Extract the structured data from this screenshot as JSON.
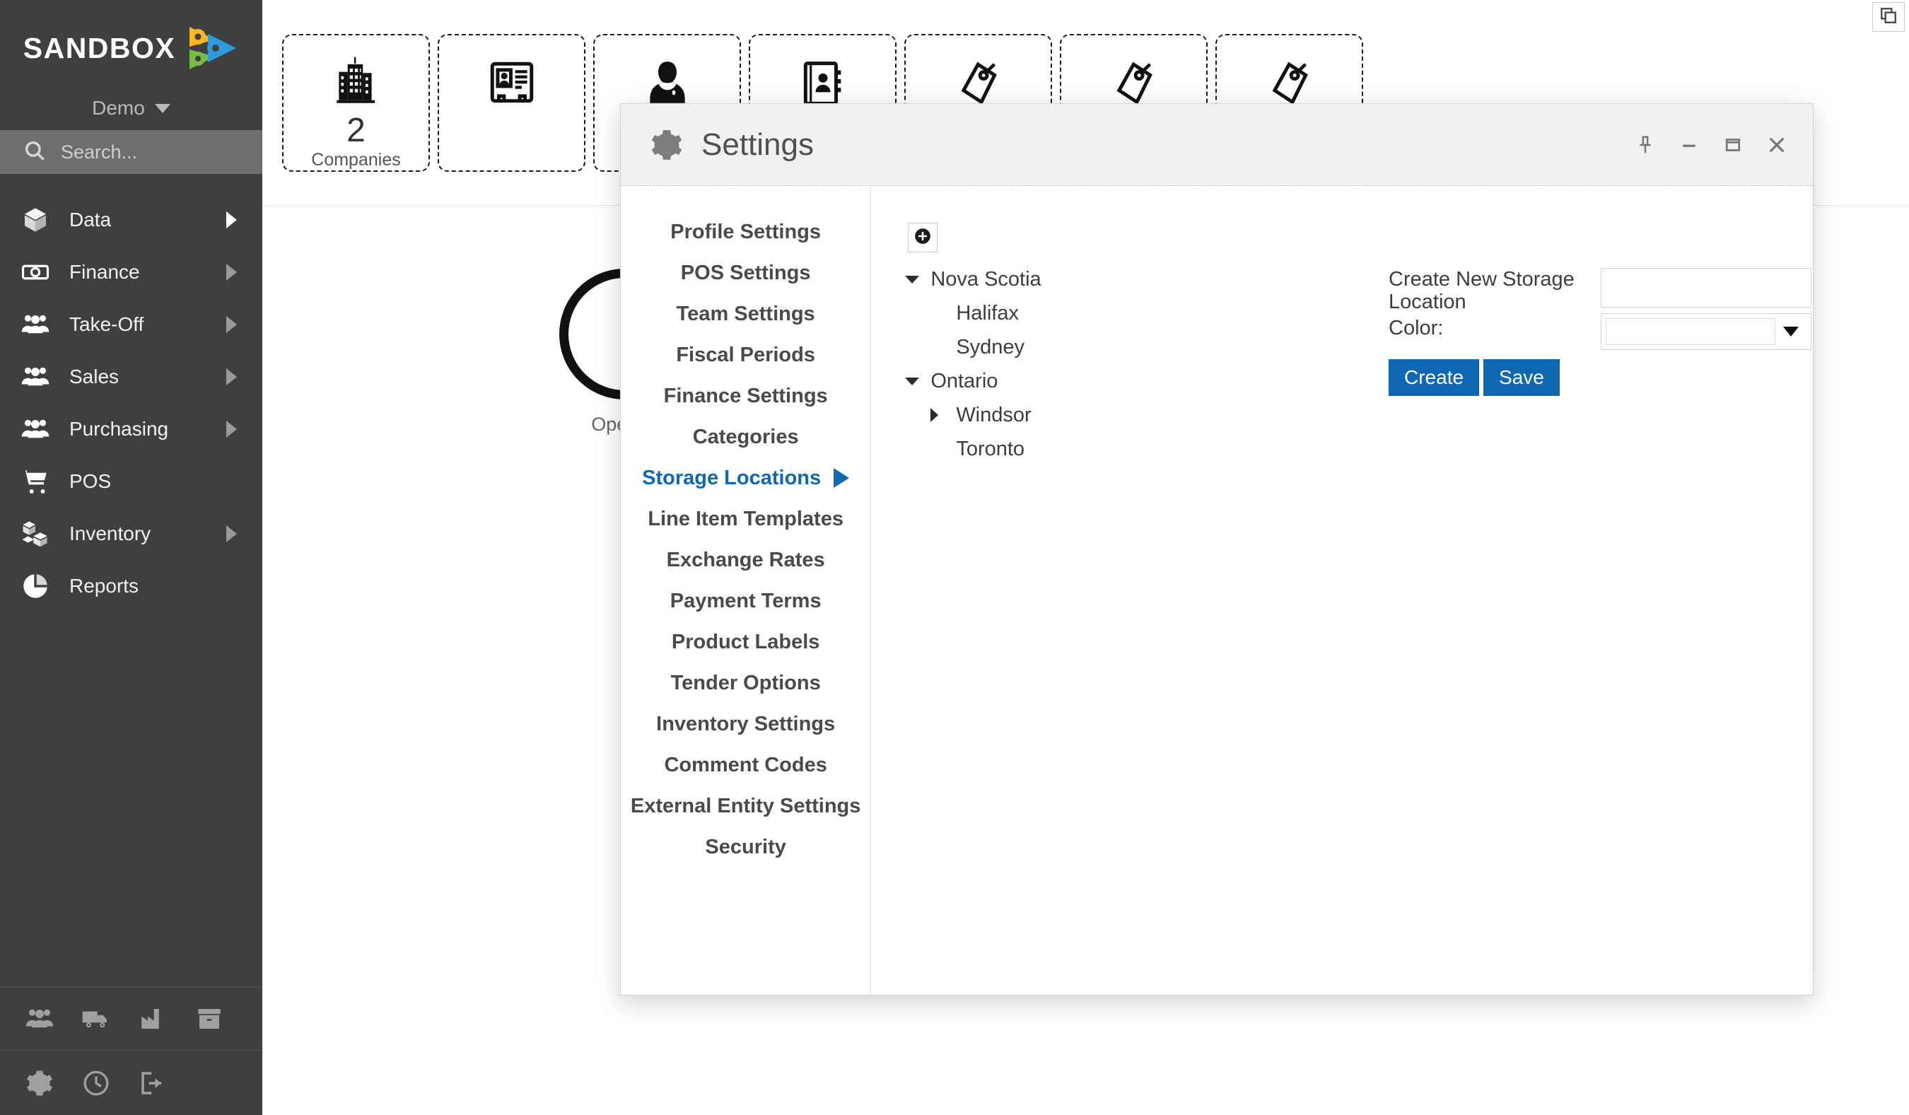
{
  "brand": {
    "name": "SANDBOX",
    "logo_icon": "sandbox-play-gears-logo",
    "tenant": "Demo",
    "tenant_caret_icon": "chevron-down-icon"
  },
  "search": {
    "placeholder": "Search...",
    "value": "",
    "icon": "search-icon"
  },
  "sidebar": {
    "items": [
      {
        "label": "Data",
        "icon": "box-icon",
        "has_chevron": true,
        "chevron_bright": true
      },
      {
        "label": "Finance",
        "icon": "banknote-icon",
        "has_chevron": true,
        "chevron_bright": false
      },
      {
        "label": "Take-Off",
        "icon": "people-icon",
        "has_chevron": true,
        "chevron_bright": false
      },
      {
        "label": "Sales",
        "icon": "people-icon",
        "has_chevron": true,
        "chevron_bright": false
      },
      {
        "label": "Purchasing",
        "icon": "people-icon",
        "has_chevron": true,
        "chevron_bright": false
      },
      {
        "label": "POS",
        "icon": "shopping-cart-icon",
        "has_chevron": false,
        "chevron_bright": false
      },
      {
        "label": "Inventory",
        "icon": "boxes-icon",
        "has_chevron": true,
        "chevron_bright": false
      },
      {
        "label": "Reports",
        "icon": "pie-chart-icon",
        "has_chevron": false,
        "chevron_bright": false
      }
    ],
    "tools_row1": [
      {
        "icon": "people-icon"
      },
      {
        "icon": "truck-icon"
      },
      {
        "icon": "factory-icon"
      },
      {
        "icon": "archive-box-icon"
      }
    ],
    "tools_row2": [
      {
        "icon": "gear-icon"
      },
      {
        "icon": "clock-icon"
      },
      {
        "icon": "logout-icon"
      }
    ]
  },
  "topbar": {
    "window_switcher_icon": "stacked-windows-icon"
  },
  "tabs": [
    {
      "icon": "office-buildings-icon",
      "count": "2",
      "label": "Companies"
    },
    {
      "icon": "id-card-icon",
      "count": "",
      "label": ""
    },
    {
      "icon": "person-silhouette-icon",
      "count": "",
      "label": ""
    },
    {
      "icon": "address-book-icon",
      "count": "",
      "label": ""
    },
    {
      "icon": "price-tag-icon",
      "count": "",
      "label": ""
    },
    {
      "icon": "price-tag-icon",
      "count": "",
      "label": ""
    },
    {
      "icon": "price-tag-icon",
      "count": "",
      "label": ""
    }
  ],
  "kpi": {
    "label": "Open Ti",
    "chart_icon": "donut-chart"
  },
  "dialog": {
    "title": "Settings",
    "title_icon": "gear-icon",
    "window_buttons": [
      {
        "name": "pin",
        "icon": "pin-icon"
      },
      {
        "name": "minimize",
        "icon": "minimize-icon"
      },
      {
        "name": "maximize",
        "icon": "maximize-icon"
      },
      {
        "name": "close",
        "icon": "close-icon"
      }
    ],
    "menu": [
      {
        "label": "Profile Settings",
        "active": false
      },
      {
        "label": "POS Settings",
        "active": false
      },
      {
        "label": "Team Settings",
        "active": false
      },
      {
        "label": "Fiscal Periods",
        "active": false
      },
      {
        "label": "Finance Settings",
        "active": false
      },
      {
        "label": "Categories",
        "active": false
      },
      {
        "label": "Storage Locations",
        "active": true
      },
      {
        "label": "Line Item Templates",
        "active": false
      },
      {
        "label": "Exchange Rates",
        "active": false
      },
      {
        "label": "Payment Terms",
        "active": false
      },
      {
        "label": "Product Labels",
        "active": false
      },
      {
        "label": "Tender Options",
        "active": false
      },
      {
        "label": "Inventory Settings",
        "active": false
      },
      {
        "label": "Comment Codes",
        "active": false
      },
      {
        "label": "External Entity Settings",
        "active": false
      },
      {
        "label": "Security",
        "active": false
      }
    ],
    "tree": {
      "add_button_icon": "plus-circle-icon",
      "nodes": [
        {
          "label": "Nova Scotia",
          "level": 0,
          "toggle": "expanded"
        },
        {
          "label": "Halifax",
          "level": 1,
          "toggle": "none"
        },
        {
          "label": "Sydney",
          "level": 1,
          "toggle": "none"
        },
        {
          "label": "Ontario",
          "level": 0,
          "toggle": "expanded"
        },
        {
          "label": "Windsor",
          "level": 1,
          "toggle": "collapsed"
        },
        {
          "label": "Toronto",
          "level": 1,
          "toggle": "none"
        }
      ]
    },
    "form": {
      "label_name": "Create New Storage Location",
      "label_color": "Color:",
      "name_value": "",
      "color_value": "",
      "color_arrow_icon": "caret-down-icon",
      "create_label": "Create",
      "save_label": "Save"
    }
  },
  "colors": {
    "accent_blue": "#1068b3",
    "sidebar_bg": "#3f3f3f",
    "search_bg": "#6e6e6e",
    "dialog_header_bg": "#f1f1f1",
    "logo_yellow": "#f5b928",
    "logo_blue": "#2d9cdb",
    "logo_green": "#79bc43"
  }
}
